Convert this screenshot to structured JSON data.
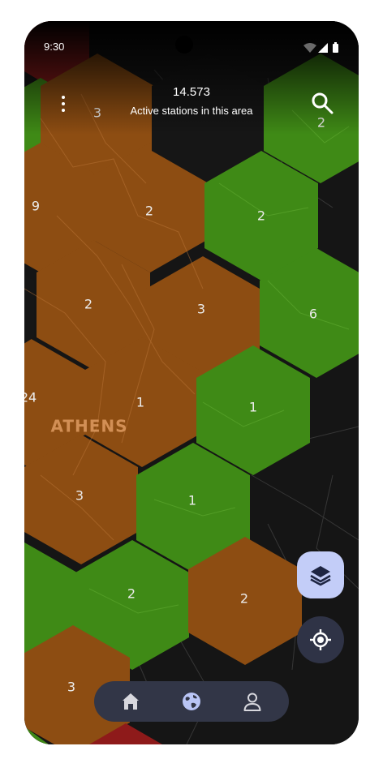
{
  "status_bar": {
    "time": "9:30"
  },
  "header": {
    "station_count": "14.573",
    "subtitle": "Active stations in this area"
  },
  "map": {
    "city_label": "ATHENS",
    "colors": {
      "orange": "#8d4d12",
      "green": "#3f8a16",
      "dark": "#161616",
      "red": "#8e1a1a"
    },
    "hex_labels": [
      "3",
      "2",
      "9",
      "2",
      "2",
      "2",
      "3",
      "6",
      "24",
      "1",
      "1",
      "3",
      "1",
      "2",
      "2",
      "3"
    ]
  },
  "fabs": {
    "layers_icon": "layers-icon",
    "locate_icon": "my-location-icon"
  },
  "bottom_nav": {
    "items": [
      {
        "icon": "home-icon"
      },
      {
        "icon": "globe-icon",
        "active": true
      },
      {
        "icon": "person-icon"
      }
    ]
  }
}
